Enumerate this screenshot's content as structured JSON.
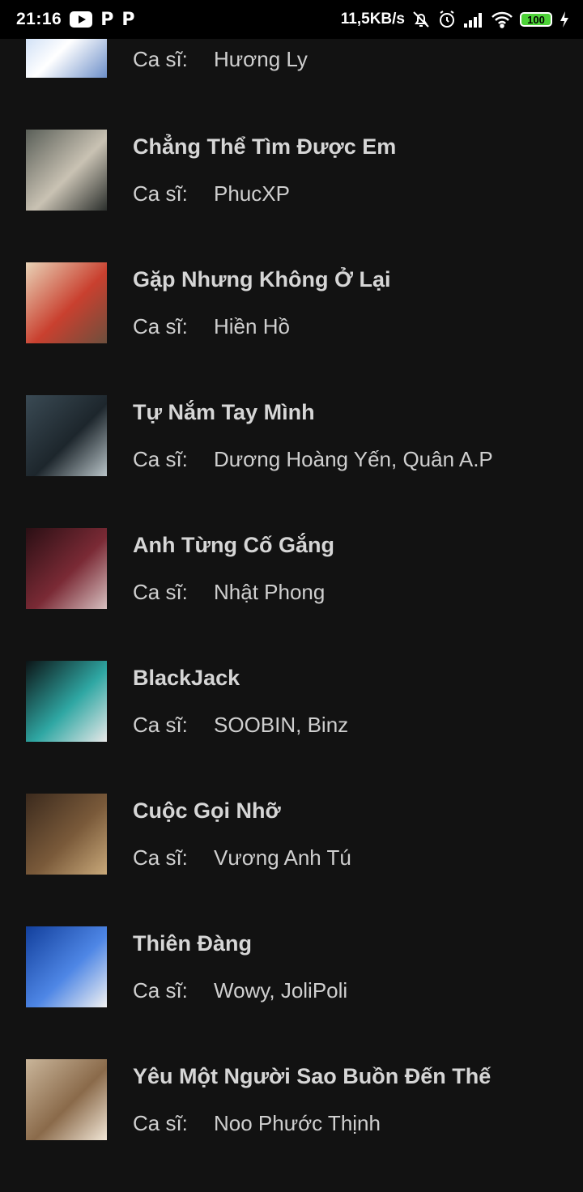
{
  "status_bar": {
    "time": "21:16",
    "network_speed": "11,5KB/s",
    "battery": "100"
  },
  "songs": [
    {
      "title": "",
      "artist_label": "Ca sĩ:",
      "artist": "Hương Ly",
      "cover_colors": [
        "#a9c7ef",
        "#ffffff",
        "#6d8fc9"
      ]
    },
    {
      "title": "Chẳng Thể Tìm Được Em",
      "artist_label": "Ca sĩ:",
      "artist": "PhucXP",
      "cover_colors": [
        "#5a5f58",
        "#c9c2b3",
        "#2b2f2c"
      ]
    },
    {
      "title": "Gặp Nhưng Không Ở Lại",
      "artist_label": "Ca sĩ:",
      "artist": "Hiền Hồ",
      "cover_colors": [
        "#e9d3b7",
        "#c9402f",
        "#6d4f3d"
      ]
    },
    {
      "title": "Tự Nắm Tay Mình",
      "artist_label": "Ca sĩ:",
      "artist": "Dương Hoàng Yến, Quân A.P",
      "cover_colors": [
        "#3a4a54",
        "#1d262c",
        "#b8c3c7"
      ]
    },
    {
      "title": "Anh Từng Cố Gắng",
      "artist_label": "Ca sĩ:",
      "artist": "Nhật Phong",
      "cover_colors": [
        "#2a0f14",
        "#7a2a35",
        "#d7c0c0"
      ]
    },
    {
      "title": "BlackJack",
      "artist_label": "Ca sĩ:",
      "artist": "SOOBIN, Binz",
      "cover_colors": [
        "#0c1416",
        "#2fa7a3",
        "#e8e8e8"
      ]
    },
    {
      "title": "Cuộc Gọi Nhỡ",
      "artist_label": "Ca sĩ:",
      "artist": "Vương Anh Tú",
      "cover_colors": [
        "#3b2a1d",
        "#7a5a3a",
        "#c9a97a"
      ]
    },
    {
      "title": "Thiên Đàng",
      "artist_label": "Ca sĩ:",
      "artist": "Wowy, JoliPoli",
      "cover_colors": [
        "#123f9c",
        "#4e86e5",
        "#f2f2f2"
      ]
    },
    {
      "title": "Yêu Một Người Sao Buồn Đến Thế",
      "artist_label": "Ca sĩ:",
      "artist": "Noo Phước Thịnh",
      "cover_colors": [
        "#c9b59a",
        "#8a6a4a",
        "#f1e6d6"
      ]
    }
  ]
}
